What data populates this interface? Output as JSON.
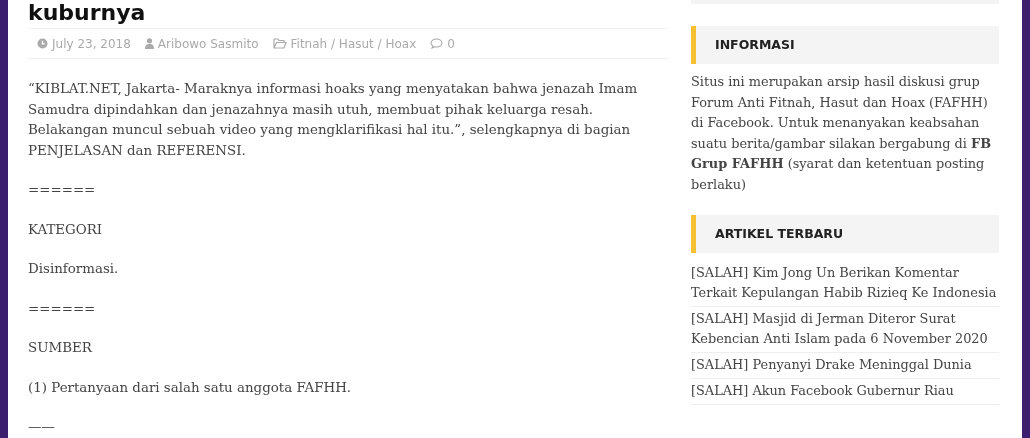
{
  "article": {
    "title": "kuburnya",
    "meta": [
      {
        "kind": "date",
        "text": "July 23, 2018"
      },
      {
        "kind": "author",
        "text": "Aribowo Sasmito"
      },
      {
        "kind": "category",
        "text": "Fitnah / Hasut / Hoax"
      },
      {
        "kind": "comments",
        "text": "0"
      }
    ],
    "paragraphs": [
      "“KIBLAT.NET, Jakarta- Maraknya informasi hoaks yang menyatakan bahwa jenazah Imam Samudra dipindahkan dan jenazahnya masih utuh, membuat pihak keluarga resah. Belakangan muncul sebuah video yang mengklarifikasi hal itu.”, selengkapnya di bagian PENJELASAN dan REFERENSI.",
      "======",
      "KATEGORI",
      "Disinformasi.",
      "======",
      "SUMBER",
      "(1) Pertanyaan dari salah satu anggota FAFHH.",
      "——"
    ]
  },
  "sidebar": {
    "widgets": [
      {
        "kind": "text",
        "title": "INFORMASI",
        "text": "Situs ini merupakan arsip hasil diskusi grup Forum Anti Fitnah, Hasut dan Hoax (FAFHH) di Facebook. Untuk menanyakan keabsahan suatu berita/gambar silakan bergabung di **FB Grup FAFHH** (syarat dan ketentuan posting berlaku)"
      },
      {
        "kind": "list",
        "title": "ARTIKEL TERBARU",
        "items": [
          "[SALAH] Kim Jong Un Berikan Komentar Terkait Kepulangan Habib Rizieq Ke Indonesia",
          "[SALAH] Masjid di Jerman Diteror Surat Kebencian Anti Islam pada 6 November 2020",
          "[SALAH] Penyanyi Drake Meninggal Dunia",
          "[SALAH] Akun Facebook Gubernur Riau"
        ]
      }
    ]
  }
}
